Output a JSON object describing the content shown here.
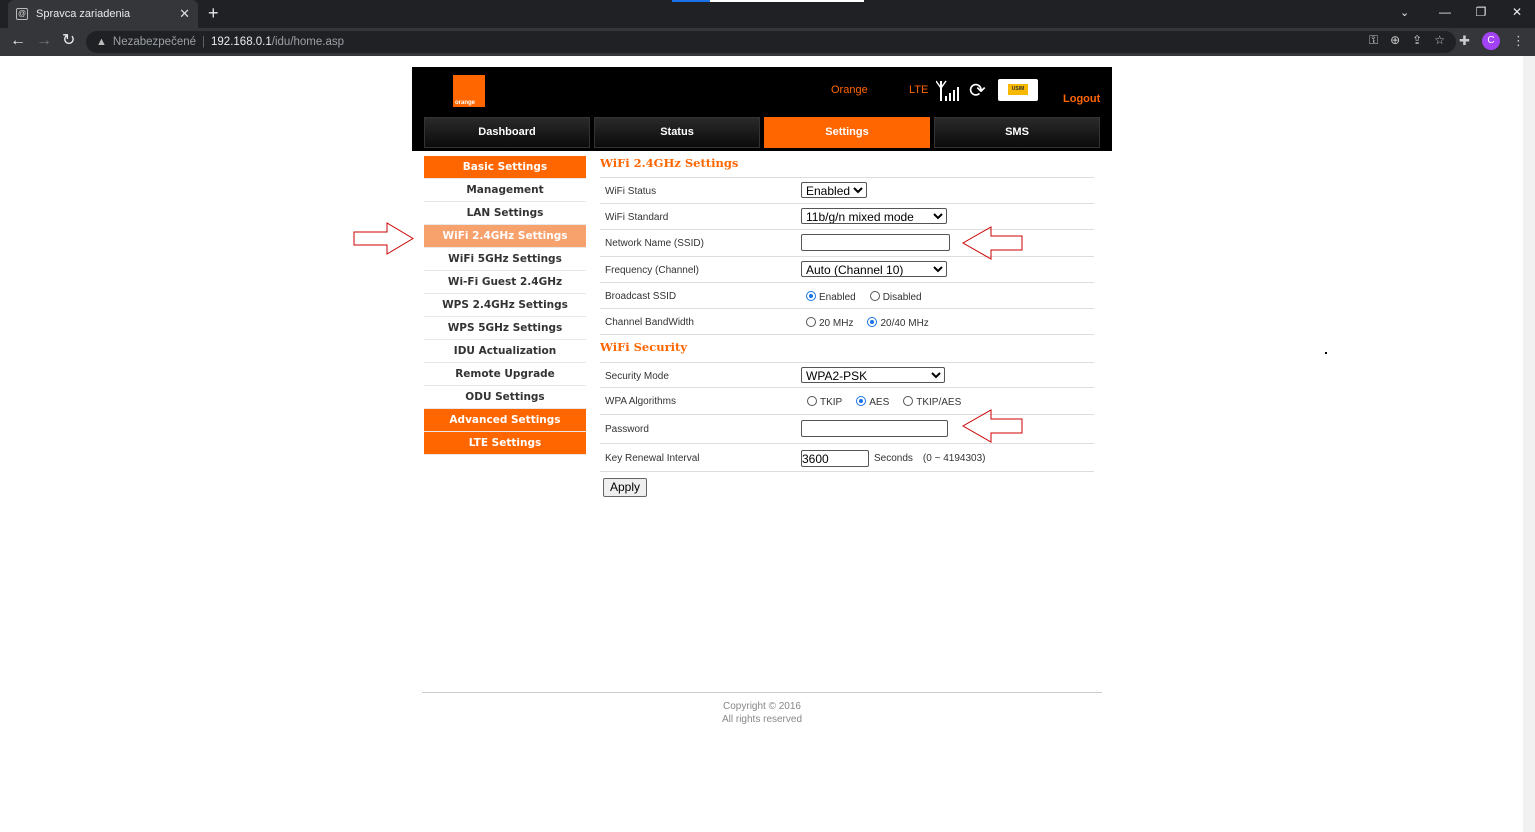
{
  "browser": {
    "tab_title": "Spravca zariadenia",
    "tab_close": "✕",
    "new_tab": "+",
    "security_label": "Nezabezpečené",
    "url_host": "192.168.0.1",
    "url_path": "/idu/home.asp",
    "profile_initial": "C"
  },
  "header": {
    "logo_text": "orange",
    "brand": "Orange",
    "network": "LTE",
    "usim": "USIM",
    "logout": "Logout"
  },
  "nav": {
    "tabs": [
      "Dashboard",
      "Status",
      "Settings",
      "SMS"
    ],
    "active": "Settings"
  },
  "sidebar": {
    "items": [
      "Basic Settings",
      "Management",
      "LAN Settings",
      "WiFi 2.4GHz Settings",
      "WiFi 5GHz Settings",
      "Wi-Fi Guest 2.4GHz",
      "WPS 2.4GHz Settings",
      "WPS 5GHz Settings",
      "IDU Actualization",
      "Remote Upgrade",
      "ODU Settings",
      "Advanced Settings",
      "LTE Settings"
    ],
    "selected": "WiFi 2.4GHz Settings"
  },
  "wifi": {
    "title": "WiFi 2.4GHz Settings",
    "status_label": "WiFi Status",
    "status_value": "Enabled",
    "standard_label": "WiFi Standard",
    "standard_value": "11b/g/n mixed mode",
    "ssid_label": "Network Name (SSID)",
    "ssid_value": "",
    "channel_label": "Frequency (Channel)",
    "channel_value": "Auto (Channel 10)",
    "broadcast_label": "Broadcast SSID",
    "broadcast_enabled": "Enabled",
    "broadcast_disabled": "Disabled",
    "bandwidth_label": "Channel BandWidth",
    "bw_20": "20 MHz",
    "bw_2040": "20/40 MHz"
  },
  "security": {
    "title": "WiFi Security",
    "mode_label": "Security Mode",
    "mode_value": "WPA2-PSK",
    "alg_label": "WPA Algorithms",
    "alg_tkip": "TKIP",
    "alg_aes": "AES",
    "alg_tkipaes": "TKIP/AES",
    "password_label": "Password",
    "password_value": "",
    "renewal_label": "Key Renewal Interval",
    "renewal_value": "3600",
    "renewal_unit": "Seconds",
    "renewal_range": "(0 ~ 4194303)"
  },
  "apply": "Apply",
  "footer": {
    "line1": "Copyright © 2016",
    "line2": "All rights reserved"
  },
  "colors": {
    "accent": "#ff6600",
    "selected_sidebar": "#f7a16d",
    "header_bg": "#000000",
    "annotation_arrow": "#cc0000"
  }
}
